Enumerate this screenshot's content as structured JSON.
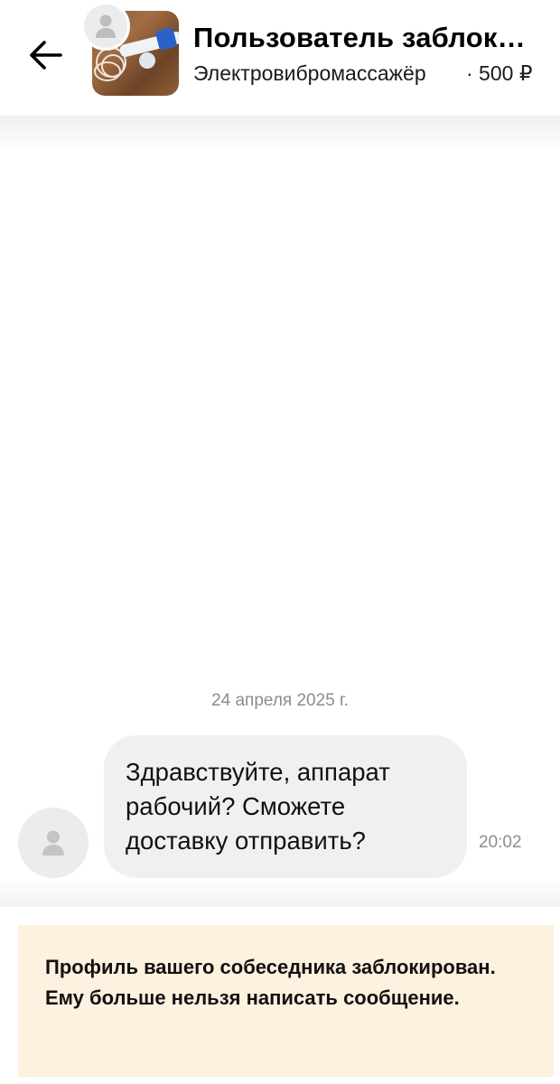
{
  "header": {
    "title": "Пользователь заблокирован",
    "item_name": "Электровибромассажёр",
    "price": "· 500 ₽"
  },
  "chat": {
    "date": "24 апреля 2025 г.",
    "messages": [
      {
        "text": "Здравствуйте, аппарат рабочий? Сможете доставку отправить?",
        "time": "20:02"
      }
    ]
  },
  "notice": {
    "text": "Профиль вашего собеседника заблокирован. Ему больше нельзя написать сообщение."
  },
  "colors": {
    "notice_background": "#fdf1e0",
    "bubble_background": "#f0f0f0",
    "muted_text": "#8c8c8c"
  },
  "icons": {
    "back": "arrow-left-icon",
    "avatar": "user-placeholder-icon"
  }
}
